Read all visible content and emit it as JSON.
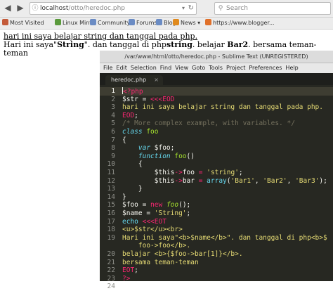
{
  "browser": {
    "url": "localhost/otto/heredoc.php",
    "url_host": "localhost",
    "url_path": "/otto/heredoc.php",
    "search_placeholder": "Search",
    "bookmarks": [
      "Most Visited",
      "Linux Mint",
      "Community",
      "Forums",
      "Blog",
      "News",
      "https://www.blogger..."
    ]
  },
  "page": {
    "line1": "hari ini saya belajar string dan tanggal pada php.",
    "line2_pre": "Hari ini saya\"",
    "line2_bold1": "String",
    "line2_mid": "\". dan tanggal di php",
    "line2_bold2": "string",
    "line2_mid2": ". belajar ",
    "line2_bold3": "Bar2",
    "line2_post": ". bersama teman-teman"
  },
  "sublime": {
    "title": "/var/www/html/otto/heredoc.php - Sublime Text (UNREGISTERED)",
    "menu": [
      "File",
      "Edit",
      "Selection",
      "Find",
      "View",
      "Goto",
      "Tools",
      "Project",
      "Preferences",
      "Help"
    ],
    "tab": "heredoc.php",
    "tab_close": "×",
    "line_numbers": [
      "1",
      "2",
      "3",
      "4",
      "5",
      "6",
      "7",
      "8",
      "9",
      "10",
      "11",
      "12",
      "13",
      "14",
      "15",
      "16",
      "17",
      "18",
      "19",
      "",
      "20",
      "21",
      "22",
      "23",
      "24"
    ],
    "code": {
      "l1": "<?php",
      "l2a": "$str = ",
      "l2b": "<<<",
      "l2c": "EOD",
      "l3": "hari ini saya belajar string dan tanggal pada php.",
      "l4": "EOD",
      "l4b": ";",
      "l5": "/* More complex example, with variables. */",
      "l6a": "class",
      "l6b": " foo",
      "l7": "{",
      "l8a": "    var",
      "l8b": " $foo;",
      "l9a": "    function",
      "l9b": " foo",
      "l9c": "()",
      "l10": "    {",
      "l11a": "        $this",
      "l11b": "->",
      "l11c": "foo",
      "l11d": " = ",
      "l11e": "'string'",
      "l11f": ";",
      "l12a": "        $this",
      "l12b": "->",
      "l12c": "bar",
      "l12d": " = ",
      "l12e": "array",
      "l12f": "(",
      "l12g": "'Bar1'",
      "l12h": ", ",
      "l12i": "'Bar2'",
      "l12j": ", ",
      "l12k": "'Bar3'",
      "l12l": ");",
      "l13": "    }",
      "l14": "}",
      "l15a": "$foo = ",
      "l15b": "new",
      "l15c": " foo",
      "l15d": "();",
      "l16a": "$name = ",
      "l16b": "'String'",
      "l16c": ";",
      "l17a": "echo",
      "l17b": " <<<",
      "l17c": "EOT",
      "l18": "<u>$str</u><br>",
      "l19": "Hari ini saya\"<b>$name</b>\". dan tanggal di php<b>$",
      "l19w": "    foo->foo</b>.",
      "l20": "belajar <b>{$foo->bar[1]}</b>.",
      "l21": "bersama teman-teman",
      "l22a": "EOT",
      "l22b": ";",
      "l23": "?>",
      "l24": ""
    }
  },
  "colors": {
    "editor_bg": "#272822",
    "keyword": "#f92672",
    "string": "#e6db74",
    "storage": "#66d9ef",
    "function": "#a6e22e",
    "comment": "#75715e"
  }
}
